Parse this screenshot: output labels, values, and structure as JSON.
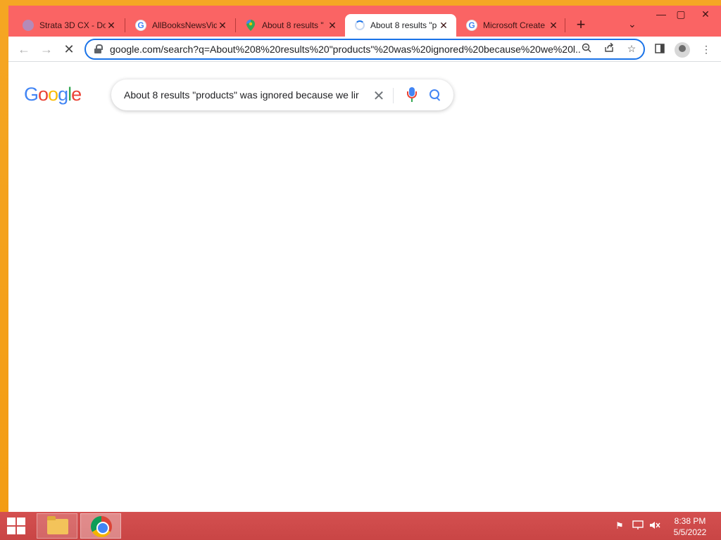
{
  "browser": {
    "tabs": [
      {
        "title": "Strata 3D CX - Do",
        "favicon": "strata-icon",
        "active": false
      },
      {
        "title": "AllBooksNewsVid",
        "favicon": "google-g-icon",
        "active": false
      },
      {
        "title": "About 8 results \"",
        "favicon": "maps-icon",
        "active": false
      },
      {
        "title": "About 8 results \"p",
        "favicon": "loading-spinner-icon",
        "active": true
      },
      {
        "title": "Microsoft Create",
        "favicon": "google-g-icon",
        "active": false
      }
    ],
    "new_tab": "+",
    "tab_search": "⌄",
    "window_controls": {
      "minimize": "—",
      "maximize": "▢",
      "close": "✕"
    },
    "url": "google.com/search?q=About%208%20results%20\"products\"%20was%20ignored%20because%20we%20l..."
  },
  "page": {
    "logo": [
      "G",
      "o",
      "o",
      "g",
      "l",
      "e"
    ],
    "logo_colors": [
      "#4285f4",
      "#ea4335",
      "#fbbc05",
      "#4285f4",
      "#34a853",
      "#ea4335"
    ],
    "search_value": "About 8 results \"products\" was ignored because we lir"
  },
  "taskbar": {
    "time": "8:38 PM",
    "date": "5/5/2022"
  }
}
